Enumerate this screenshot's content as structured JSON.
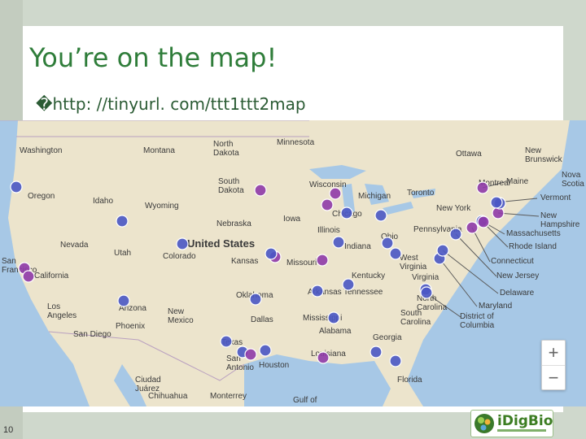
{
  "slide": {
    "title": "You’re on the map!",
    "url_line": "�http: //tinyurl. com/ttt1ttt2map",
    "page_number": "10",
    "logo_text": "iDigBio"
  },
  "map": {
    "colors": {
      "land": "#ece4cc",
      "water": "#a7c8e6",
      "blue_marker": "#4a57c4",
      "purple_marker": "#8f3aa8"
    },
    "zoom_in": "+",
    "zoom_out": "−",
    "labels": [
      {
        "text": "Washington"
      },
      {
        "text": "Montana"
      },
      {
        "text": "North Dakota"
      },
      {
        "text": "Minnesota"
      },
      {
        "text": "Oregon"
      },
      {
        "text": "Idaho"
      },
      {
        "text": "Wyoming"
      },
      {
        "text": "South Dakota"
      },
      {
        "text": "Wisconsin"
      },
      {
        "text": "Michigan"
      },
      {
        "text": "Toronto"
      },
      {
        "text": "Ottawa"
      },
      {
        "text": "Montreal"
      },
      {
        "text": "New Brunswick"
      },
      {
        "text": "Maine"
      },
      {
        "text": "Nova Scotia"
      },
      {
        "text": "Vermont"
      },
      {
        "text": "New Hampshire"
      },
      {
        "text": "Massachusetts"
      },
      {
        "text": "Rhode Island"
      },
      {
        "text": "Connecticut"
      },
      {
        "text": "New Jersey"
      },
      {
        "text": "Delaware"
      },
      {
        "text": "Maryland"
      },
      {
        "text": "District of Columbia"
      },
      {
        "text": "New York"
      },
      {
        "text": "Chicago"
      },
      {
        "text": "Iowa"
      },
      {
        "text": "Nebraska"
      },
      {
        "text": "United States"
      },
      {
        "text": "Nevada"
      },
      {
        "text": "Utah"
      },
      {
        "text": "Colorado"
      },
      {
        "text": "Kansas"
      },
      {
        "text": "Missouri"
      },
      {
        "text": "Illinois"
      },
      {
        "text": "Indiana"
      },
      {
        "text": "Ohio"
      },
      {
        "text": "Pennsylvania"
      },
      {
        "text": "West Virginia"
      },
      {
        "text": "Virginia"
      },
      {
        "text": "Kentucky"
      },
      {
        "text": "Tennessee"
      },
      {
        "text": "North Carolina"
      },
      {
        "text": "South Carolina"
      },
      {
        "text": "Oklahoma"
      },
      {
        "text": "Arkansas"
      },
      {
        "text": "Mississippi"
      },
      {
        "text": "Alabama"
      },
      {
        "text": "Georgia"
      },
      {
        "text": "Louisiana"
      },
      {
        "text": "Texas"
      },
      {
        "text": "Dallas"
      },
      {
        "text": "San Antonio"
      },
      {
        "text": "Houston"
      },
      {
        "text": "Monterrey"
      },
      {
        "text": "Gulf of"
      },
      {
        "text": "New Mexico"
      },
      {
        "text": "Arizona"
      },
      {
        "text": "Phoenix"
      },
      {
        "text": "Los Angeles"
      },
      {
        "text": "San Diego"
      },
      {
        "text": "San Francisco"
      },
      {
        "text": "California"
      },
      {
        "text": "Ciudad Juárez"
      },
      {
        "text": "Chihuahua"
      },
      {
        "text": "Florida"
      }
    ],
    "markers": [
      {
        "color": "blue"
      },
      {
        "color": "purple"
      },
      {
        "color": "purple"
      },
      {
        "color": "purple"
      },
      {
        "color": "blue"
      },
      {
        "color": "blue"
      },
      {
        "color": "blue"
      },
      {
        "color": "purple"
      },
      {
        "color": "purple"
      },
      {
        "color": "purple"
      },
      {
        "color": "blue"
      },
      {
        "color": "blue"
      },
      {
        "color": "blue"
      },
      {
        "color": "blue"
      },
      {
        "color": "blue"
      },
      {
        "color": "blue"
      },
      {
        "color": "blue"
      },
      {
        "color": "purple"
      },
      {
        "color": "purple"
      },
      {
        "color": "purple"
      },
      {
        "color": "blue"
      },
      {
        "color": "purple"
      },
      {
        "color": "blue"
      },
      {
        "color": "blue"
      },
      {
        "color": "blue"
      },
      {
        "color": "blue"
      },
      {
        "color": "blue"
      },
      {
        "color": "blue"
      },
      {
        "color": "blue"
      },
      {
        "color": "blue"
      },
      {
        "color": "blue"
      },
      {
        "color": "blue"
      },
      {
        "color": "purple"
      },
      {
        "color": "purple"
      },
      {
        "color": "blue"
      },
      {
        "color": "blue"
      },
      {
        "color": "blue"
      },
      {
        "color": "blue"
      },
      {
        "color": "purple"
      },
      {
        "color": "blue"
      }
    ]
  }
}
